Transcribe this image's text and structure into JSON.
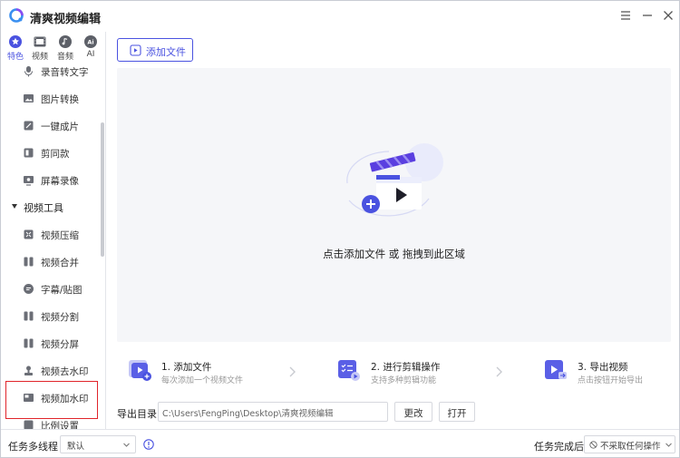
{
  "app": {
    "title": "清爽视频编辑"
  },
  "category_tabs": [
    {
      "label": "特色",
      "icon": "star-icon",
      "active": true
    },
    {
      "label": "视频",
      "icon": "film-icon",
      "active": false
    },
    {
      "label": "音频",
      "icon": "music-icon",
      "active": false
    },
    {
      "label": "AI",
      "icon": "ai-icon",
      "active": false
    }
  ],
  "sidebar": {
    "items_top": [
      {
        "label": "录音转文字",
        "icon": "mic-icon"
      },
      {
        "label": "图片转换",
        "icon": "image-icon"
      },
      {
        "label": "一键成片",
        "icon": "magic-icon"
      },
      {
        "label": "剪同款",
        "icon": "template-icon"
      },
      {
        "label": "屏幕录像",
        "icon": "screen-record-icon"
      }
    ],
    "group": {
      "label": "视频工具",
      "expanded": true
    },
    "items_group": [
      {
        "label": "视频压缩",
        "icon": "compress-icon"
      },
      {
        "label": "视频合并",
        "icon": "merge-icon"
      },
      {
        "label": "字幕/贴图",
        "icon": "subtitle-icon"
      },
      {
        "label": "视频分割",
        "icon": "split-icon"
      },
      {
        "label": "视频分屏",
        "icon": "split-screen-icon"
      },
      {
        "label": "视频去水印",
        "icon": "stamp-icon"
      },
      {
        "label": "视频加水印",
        "icon": "watermark-icon"
      },
      {
        "label": "比例设置",
        "icon": "ratio-icon"
      }
    ],
    "selected_label": "视频加水印"
  },
  "main": {
    "add_file_label": "添加文件",
    "dropzone_text": "点击添加文件 或 拖拽到此区域",
    "steps": [
      {
        "title": "1. 添加文件",
        "subtitle": "每次添加一个视频文件",
        "icon": "add-video-icon"
      },
      {
        "title": "2. 进行剪辑操作",
        "subtitle": "支持多种剪辑功能",
        "icon": "edit-list-icon"
      },
      {
        "title": "3. 导出视频",
        "subtitle": "点击按钮开始导出",
        "icon": "export-video-icon"
      }
    ],
    "output": {
      "label": "导出目录",
      "path": "C:\\Users\\FengPing\\Desktop\\清爽视频编辑",
      "change_label": "更改",
      "open_label": "打开"
    }
  },
  "bottom": {
    "threads_label": "任务多线程",
    "threads_value": "默认",
    "after_label": "任务完成后",
    "after_value": "不采取任何操作"
  },
  "colors": {
    "accent": "#4a52e0",
    "highlight_box": "#e0242a",
    "dropzone_bg": "#f5f6f9"
  }
}
